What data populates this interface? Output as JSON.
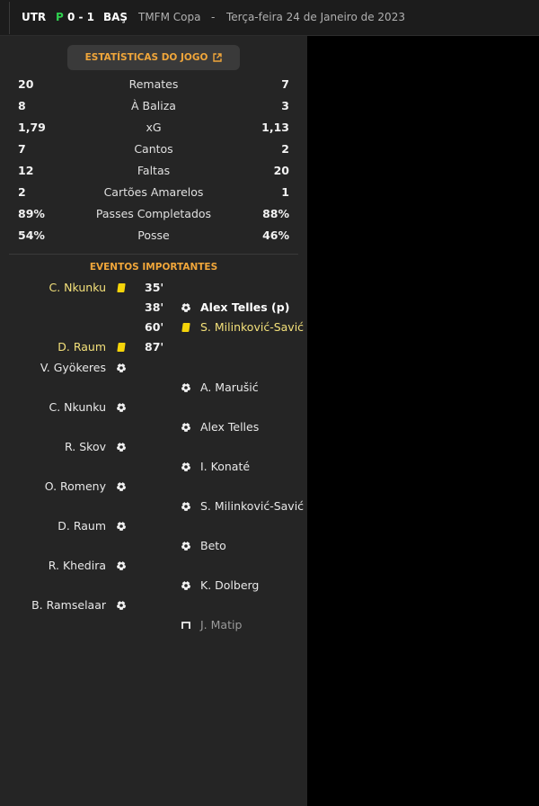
{
  "header": {
    "home_code": "UTR",
    "penalty_marker": "P",
    "score": "0 - 1",
    "away_code": "BAŞ",
    "competition": "TMFM Copa",
    "separator": "-",
    "date": "Terça-feira 24 de Janeiro de 2023"
  },
  "stats_button": {
    "label": "ESTATÍSTICAS DO JOGO",
    "icon": "external-link-icon"
  },
  "stats": [
    {
      "label": "Remates",
      "home": "20",
      "away": "7"
    },
    {
      "label": "À Baliza",
      "home": "8",
      "away": "3"
    },
    {
      "label": "xG",
      "home": "1,79",
      "away": "1,13"
    },
    {
      "label": "Cantos",
      "home": "7",
      "away": "2"
    },
    {
      "label": "Faltas",
      "home": "12",
      "away": "20"
    },
    {
      "label": "Cartões Amarelos",
      "home": "2",
      "away": "1"
    },
    {
      "label": "Passes Completados",
      "home": "89%",
      "away": "88%"
    },
    {
      "label": "Posse",
      "home": "54%",
      "away": "46%"
    }
  ],
  "events_title": "EVENTOS IMPORTANTES",
  "events": [
    {
      "side": "home",
      "player": "C. Nkunku",
      "minute": "35'",
      "icon": "yellow-card-icon"
    },
    {
      "side": "away",
      "player": "Alex Telles (p)",
      "minute": "38'",
      "icon": "ball-icon"
    },
    {
      "side": "away",
      "player": "S. Milinković-Savić",
      "minute": "60'",
      "icon": "yellow-card-icon"
    },
    {
      "side": "home",
      "player": "D. Raum",
      "minute": "87'",
      "icon": "yellow-card-icon"
    }
  ],
  "shootout": [
    {
      "side": "home",
      "player": "V. Gyökeres",
      "icon": "ball-icon"
    },
    {
      "side": "away",
      "player": "A. Marušić",
      "icon": "ball-icon"
    },
    {
      "side": "home",
      "player": "C. Nkunku",
      "icon": "ball-icon"
    },
    {
      "side": "away",
      "player": "Alex Telles",
      "icon": "ball-icon"
    },
    {
      "side": "home",
      "player": "R. Skov",
      "icon": "ball-icon"
    },
    {
      "side": "away",
      "player": "I. Konaté",
      "icon": "ball-icon"
    },
    {
      "side": "home",
      "player": "O. Romeny",
      "icon": "ball-icon"
    },
    {
      "side": "away",
      "player": "S. Milinković-Savić",
      "icon": "ball-icon"
    },
    {
      "side": "home",
      "player": "D. Raum",
      "icon": "ball-icon"
    },
    {
      "side": "away",
      "player": "Beto",
      "icon": "ball-icon"
    },
    {
      "side": "home",
      "player": "R. Khedira",
      "icon": "ball-icon"
    },
    {
      "side": "away",
      "player": "K. Dolberg",
      "icon": "ball-icon"
    },
    {
      "side": "home",
      "player": "B. Ramselaar",
      "icon": "ball-icon"
    },
    {
      "side": "away",
      "player": "J. Matip",
      "icon": "missed-goal-icon"
    }
  ],
  "colors": {
    "accent": "#f0a63a",
    "penalty": "#2fd04f",
    "yellow_card": "#f5d40a",
    "panel": "#252525"
  }
}
